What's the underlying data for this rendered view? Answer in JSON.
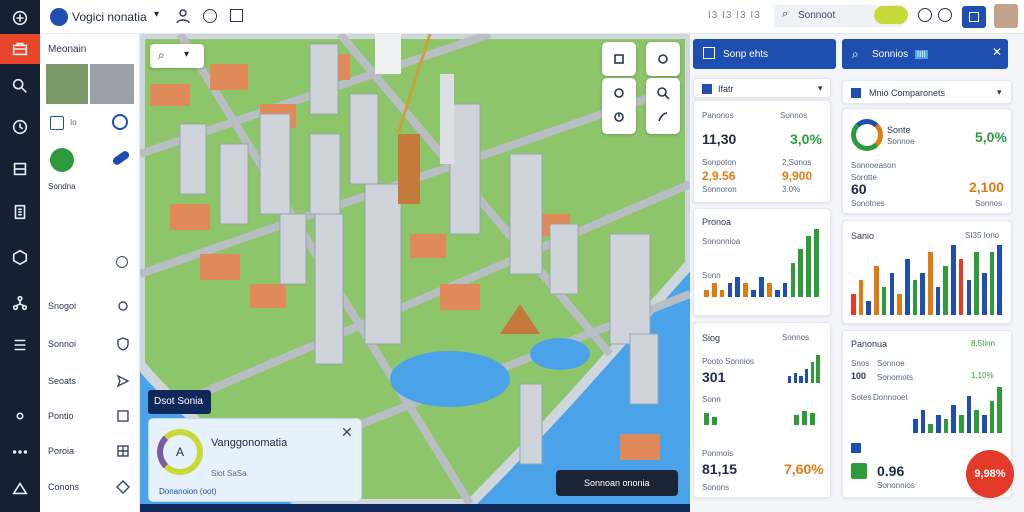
{
  "app": {
    "title": "Vogici nonatia"
  },
  "topbar": {
    "mini_label": "I3 I3 I3 I3",
    "search_label": "Sonnoot"
  },
  "side": {
    "title": "Meonain",
    "green_label": "Sondna",
    "items": [
      "Snogoi",
      "Sonnoi",
      "Seoats",
      "Pontio",
      "Poroia",
      "Conons"
    ]
  },
  "map": {
    "chip_label": "Dsot Sonia",
    "info_title": "Vanggonomatia",
    "info_sub": "Siot SaSa",
    "info_link": "Donanoion (oot)",
    "gauge_value": "A",
    "toast_label": "Sonnoan ononia"
  },
  "panel_left": {
    "header": "Sonp ehts",
    "section": "Ifatr",
    "card1": {
      "label": "Panonos",
      "value": "11,30",
      "delta": "3,0%",
      "delta_label": "Sonnos",
      "label2": "Sonpoton",
      "value2": "2,9.56",
      "value3": "2,Sonos",
      "value4": "9,900",
      "value5": "3.0%"
    },
    "card2": {
      "label": "Pronoa",
      "sub": "Sononnioa",
      "sub2": "Sonn"
    },
    "card3": {
      "label": "Siog",
      "value_label": "Sonnos",
      "sub": "Pooto Sonnios",
      "value": "301",
      "sub2": "Sonn",
      "value2": "81,15",
      "value3": "7,60%",
      "sub3": "Ponmois",
      "sub4": "Sonons"
    }
  },
  "panel_right": {
    "header": "Sonnios",
    "header_badge": "IIII",
    "section": "Mnio Comparonets",
    "card1": {
      "label": "Sonte",
      "sub": "Sonnoe",
      "value": "5,0%",
      "sub2": "Sonnoeason",
      "sub3": "Sorotte",
      "value2": "60",
      "sub4": "Sonotnes",
      "value3": "2,100",
      "sub5": "Sonnos"
    },
    "card2": {
      "label": "Sanio",
      "value": "SI35 Iono"
    },
    "card3": {
      "label": "Panonua",
      "value": "8,5Iinn",
      "sub": "Snos",
      "sub2": "Sonnoe",
      "value2": "100",
      "sub3": "Sonomots",
      "value3": "1,10%",
      "sub4": "Sotes",
      "sub5": "Donnooet",
      "value4": "0.96",
      "sub6": "Sononnios"
    },
    "fab": "9,98%"
  },
  "chart_data": [
    {
      "type": "bar",
      "title": "Pronoa",
      "series": [
        {
          "values": [
            1,
            2,
            1,
            2,
            3,
            2,
            1,
            3,
            2,
            1,
            2,
            5,
            7,
            9,
            10
          ]
        }
      ]
    },
    {
      "type": "bar",
      "title": "Sanio",
      "series": [
        {
          "values": [
            3,
            5,
            2,
            7,
            4,
            6,
            3,
            8,
            5,
            6,
            9,
            4,
            7,
            10,
            8,
            5,
            9,
            6,
            9,
            10
          ]
        }
      ]
    },
    {
      "type": "bar",
      "title": "Siog",
      "series": [
        {
          "values": [
            2,
            3,
            2,
            4,
            6,
            8
          ]
        }
      ]
    },
    {
      "type": "bar",
      "title": "Panonua",
      "series": [
        {
          "values": [
            3,
            5,
            2,
            4,
            3,
            6,
            4,
            8,
            5,
            4,
            7,
            10
          ]
        }
      ]
    }
  ],
  "colors": {
    "rail": "#162033",
    "primary": "#1e4fb0",
    "green": "#2e9b3a",
    "orange": "#e07b12",
    "water": "#4aa3e8",
    "fab": "#e53a2a"
  }
}
